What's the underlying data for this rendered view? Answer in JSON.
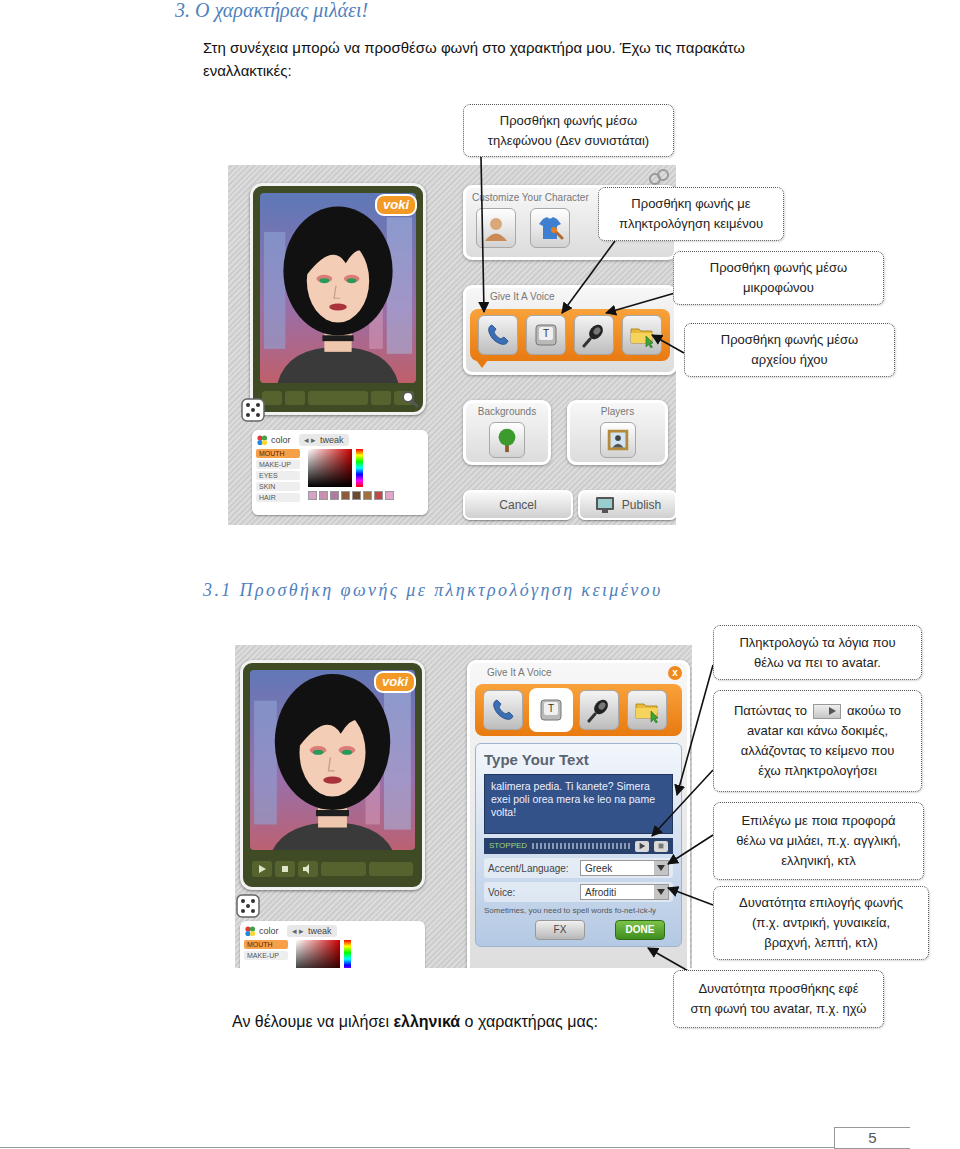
{
  "heading": "3. Ο χαρακτήρας μιλάει!",
  "intro": "Στη συνέχεια μπορώ να προσθέσω φωνή στο χαρακτήρα μου. Έχω τις παρακάτω εναλλακτικές:",
  "figure1": {
    "callouts": [
      {
        "lines": [
          "Προσθήκη φωνής μέσω",
          "τηλεφώνου (Δεν συνιστάται)"
        ]
      },
      {
        "lines": [
          "Προσθήκη φωνής με",
          "πληκτρολόγηση κειμένου"
        ]
      },
      {
        "lines": [
          "Προσθήκη φωνής μέσω",
          "μικροφώνου"
        ]
      },
      {
        "lines": [
          "Προσθήκη φωνής μέσω",
          "αρχείου ήχου"
        ]
      }
    ],
    "editor": {
      "logo": "voki",
      "customize_title": "Customize Your Character",
      "voice_title": "Give It A Voice",
      "tools": [
        {
          "kind": "phone",
          "selected": false
        },
        {
          "kind": "text",
          "glyph": "T",
          "selected": false
        },
        {
          "kind": "mic",
          "selected": false
        },
        {
          "kind": "file",
          "selected": false
        }
      ],
      "backgrounds": "Backgrounds",
      "players": "Players",
      "cancel": "Cancel",
      "publish": "Publish",
      "color_panel": {
        "tab": "color",
        "tweak_arrows": "◂ ▸",
        "tweak": "tweak",
        "items": [
          {
            "label": "MOUTH",
            "selected": true
          },
          {
            "label": "MAKE-UP",
            "selected": false
          },
          {
            "label": "EYES",
            "selected": false
          },
          {
            "label": "SKIN",
            "selected": false
          },
          {
            "label": "HAIR",
            "selected": false
          }
        ],
        "swatches": [
          "#d9a0c8",
          "#c98fb0",
          "#b07aa0",
          "#8a5a3a",
          "#6b4a2e",
          "#a07040",
          "#c04848",
          "#e0a8c8"
        ]
      }
    }
  },
  "section_heading": "3.1 Προσθήκη φωνής με πληκτρολόγηση κειμένου",
  "figure2": {
    "callouts": [
      {
        "lines": [
          "Πληκτρολογώ τα λόγια που",
          "θέλω να πει το avatar."
        ]
      },
      {
        "first": [
          "Πατώντας το",
          "ακούω το"
        ],
        "lines": [
          "avatar και κάνω δοκιμές,",
          "αλλάζοντας το κείμενο που",
          "έχω πληκτρολογήσει"
        ]
      },
      {
        "lines": [
          "Επιλέγω με ποια προφορά",
          "θέλω να μιλάει, π.χ. αγγλική,",
          "ελληνική, κτλ"
        ]
      },
      {
        "lines": [
          "Δυνατότητα επιλογής φωνής",
          "(π.χ. αντρική, γυναικεία,",
          "βραχνή, λεπτή, κτλ)"
        ]
      },
      {
        "lines": [
          "Δυνατότητα προσθήκης εφέ",
          "στη φωνή του avatar, π.χ. ηχώ"
        ]
      }
    ],
    "editor": {
      "logo": "voki",
      "voice_title": "Give It A Voice",
      "close": "x",
      "tools": [
        {
          "kind": "phone",
          "selected": false
        },
        {
          "kind": "text",
          "glyph": "T",
          "selected": true
        },
        {
          "kind": "mic",
          "selected": false
        },
        {
          "kind": "file",
          "selected": false
        }
      ],
      "type_title": "Type Your Text",
      "text": "kalimera pedia. Ti kanete? Simera exei poli orea mera ke leo na pame volta!",
      "status": "STOPPED",
      "level": 0,
      "accent_label": "Accent/Language:",
      "accent_value": "Greek",
      "voice_label": "Voice:",
      "voice_value": "Afroditi",
      "hint": "Sometimes, you need to spell words fo-net-ick-ly",
      "fx": "FX",
      "done": "DONE",
      "color_panel": {
        "tab": "color",
        "tweak_arrows": "◂ ▸",
        "tweak": "tweak",
        "items": [
          {
            "label": "MOUTH",
            "selected": true
          },
          {
            "label": "MAKE-UP",
            "selected": false
          }
        ]
      }
    }
  },
  "note": {
    "before": "Αν θέλουμε να μιλήσει ",
    "bold": "ελληνικά",
    "after": " ο χαρακτήρας μας:"
  },
  "page_number": "5"
}
